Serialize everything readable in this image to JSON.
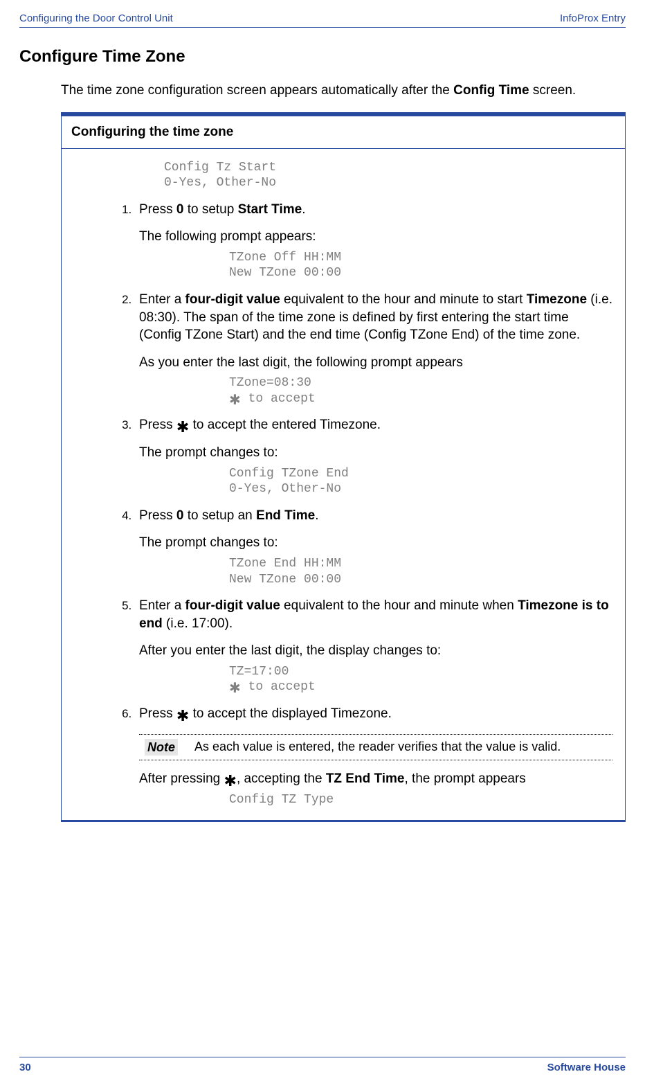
{
  "header": {
    "left": "Configuring the Door Control Unit",
    "right": "InfoProx Entry"
  },
  "section_title": "Configure Time Zone",
  "intro_pre": "The time zone configuration screen appears automatically after the ",
  "intro_bold": "Config Time",
  "intro_post": " screen.",
  "proc_title": "Configuring the time zone",
  "code1_l1": "Config Tz Start",
  "code1_l2": "0-Yes, Other-No",
  "step1_a": "Press ",
  "step1_b": "0",
  "step1_c": " to setup ",
  "step1_d": "Start Time",
  "step1_e": ".",
  "step1_p": "The following prompt appears:",
  "code2_l1": "TZone Off HH:MM",
  "code2_l2": "New TZone 00:00",
  "step2_a": "Enter a ",
  "step2_b": "four-digit value",
  "step2_c": " equivalent to the hour and minute to start ",
  "step2_d": "Timezone",
  "step2_e": " (i.e. 08:30). The span of the time zone is defined by first entering the start time (Config TZone Start) and the end time (Config TZone End) of the time zone.",
  "step2_p": "As you enter the last digit, the following prompt appears",
  "code3_l1": "TZone=08:30",
  "code3_l2": " to accept",
  "step3_a": "Press ",
  "step3_b": " to accept the entered Timezone.",
  "step3_p": "The prompt changes to:",
  "code4_l1": "Config TZone End",
  "code4_l2": "0-Yes, Other-No",
  "step4_a": "Press ",
  "step4_b": "0",
  "step4_c": " to setup an ",
  "step4_d": "End Time",
  "step4_e": ".",
  "step4_p": "The prompt changes to:",
  "code5_l1": "TZone End HH:MM",
  "code5_l2": "New TZone 00:00",
  "step5_a": "Enter a ",
  "step5_b": "four-digit value",
  "step5_c": " equivalent to the hour and minute when ",
  "step5_d": "Timezone is to end",
  "step5_e": " (i.e. 17:00).",
  "step5_p": "After you enter the last digit, the display changes to:",
  "code6_l1": "TZ=17:00",
  "code6_l2": " to accept",
  "step6_a": "Press ",
  "step6_b": " to accept the displayed Timezone.",
  "note_label": "Note",
  "note_text": "As each value is entered, the reader verifies that the value is valid.",
  "step6_p_a": "After pressing ",
  "step6_p_b": ", accepting the ",
  "step6_p_c": "TZ End Time",
  "step6_p_d": ", the prompt appears",
  "code7_l1": "Config TZ Type",
  "footer": {
    "page": "30",
    "brand": "Software House"
  },
  "asterisk": "✱"
}
